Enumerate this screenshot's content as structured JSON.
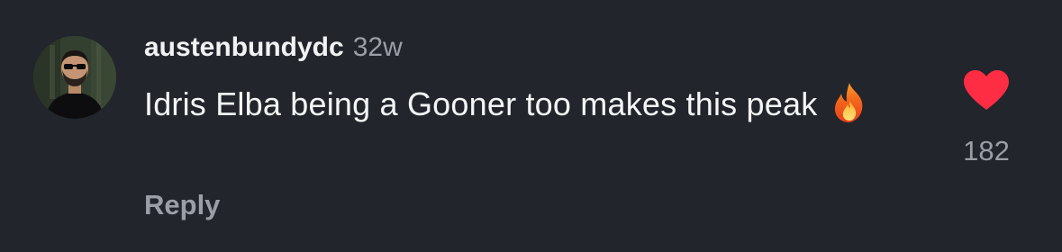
{
  "comment": {
    "username": "austenbundydc",
    "timestamp": "32w",
    "text": "Idris Elba being a Gooner too makes this peak",
    "emoji": "fire-icon",
    "reply_label": "Reply",
    "likes": "182",
    "liked": true
  },
  "colors": {
    "background": "#22252b",
    "heart": "#ff2d43",
    "muted": "#9a9ea6"
  }
}
